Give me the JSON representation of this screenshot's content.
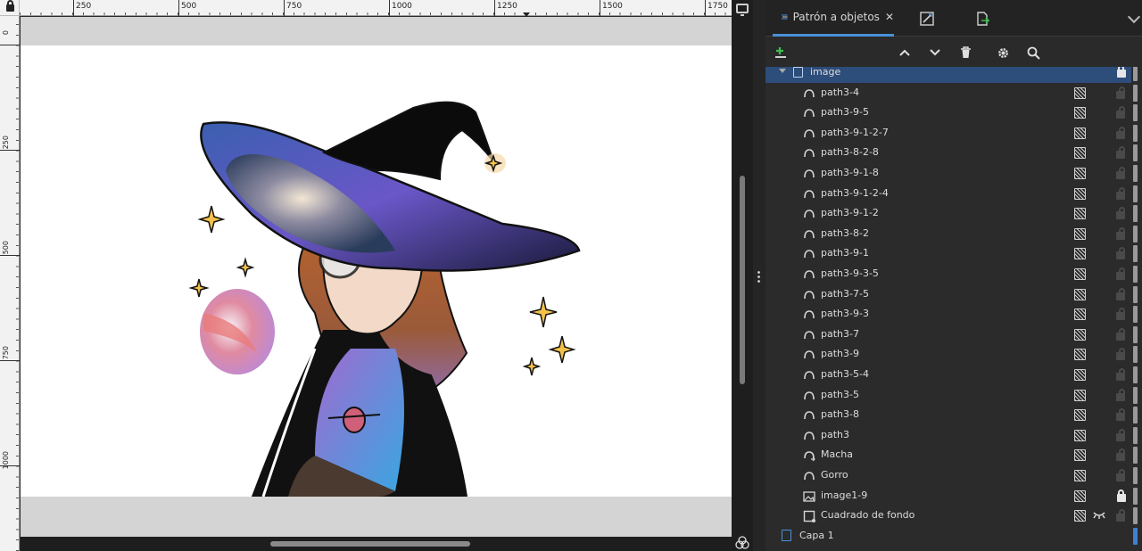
{
  "rulers": {
    "h_labels": [
      "250",
      "500",
      "750",
      "1000",
      "1250",
      "1500",
      "1750"
    ],
    "v_labels": [
      "0",
      "250",
      "500",
      "750",
      "1000"
    ]
  },
  "dock": {
    "tabs": {
      "objects_label": "Patrón a objetos",
      "objects_icon": "layers-objects-icon",
      "xml_icon": "xml-editor-icon",
      "export_icon": "export-icon"
    },
    "toolbar": {
      "add_icon": "add-layer-icon",
      "up_icon": "chevron-up-icon",
      "down_icon": "chevron-down-icon",
      "delete_icon": "trash-icon",
      "settings_icon": "gear-icon",
      "search_icon": "search-icon"
    }
  },
  "tree": {
    "group": {
      "label": "image",
      "locked": true
    },
    "items": [
      {
        "label": "path3-4",
        "icon": "path-icon"
      },
      {
        "label": "path3-9-5",
        "icon": "path-icon"
      },
      {
        "label": "path3-9-1-2-7",
        "icon": "path-icon"
      },
      {
        "label": "path3-8-2-8",
        "icon": "path-icon"
      },
      {
        "label": "path3-9-1-8",
        "icon": "path-icon"
      },
      {
        "label": "path3-9-1-2-4",
        "icon": "path-icon"
      },
      {
        "label": "path3-9-1-2",
        "icon": "path-icon"
      },
      {
        "label": "path3-8-2",
        "icon": "path-icon"
      },
      {
        "label": "path3-9-1",
        "icon": "path-icon"
      },
      {
        "label": "path3-9-3-5",
        "icon": "path-icon"
      },
      {
        "label": "path3-7-5",
        "icon": "path-icon"
      },
      {
        "label": "path3-9-3",
        "icon": "path-icon"
      },
      {
        "label": "path3-7",
        "icon": "path-icon"
      },
      {
        "label": "path3-9",
        "icon": "path-icon"
      },
      {
        "label": "path3-5-4",
        "icon": "path-icon"
      },
      {
        "label": "path3-5",
        "icon": "path-icon"
      },
      {
        "label": "path3-8",
        "icon": "path-icon"
      },
      {
        "label": "path3",
        "icon": "path-icon"
      },
      {
        "label": "Macha",
        "icon": "path-clone-icon"
      },
      {
        "label": "Gorro",
        "icon": "path-icon"
      },
      {
        "label": "image1-9",
        "icon": "image-icon",
        "locked": true
      },
      {
        "label": "Cuadrado de fondo",
        "icon": "rect-icon",
        "hidden": true
      }
    ],
    "layer": {
      "label": "Capa 1"
    }
  },
  "colors": {
    "accent": "#4a90d9",
    "selected_row": "#2d4d7a",
    "panel_bg": "#2b2b2b"
  }
}
